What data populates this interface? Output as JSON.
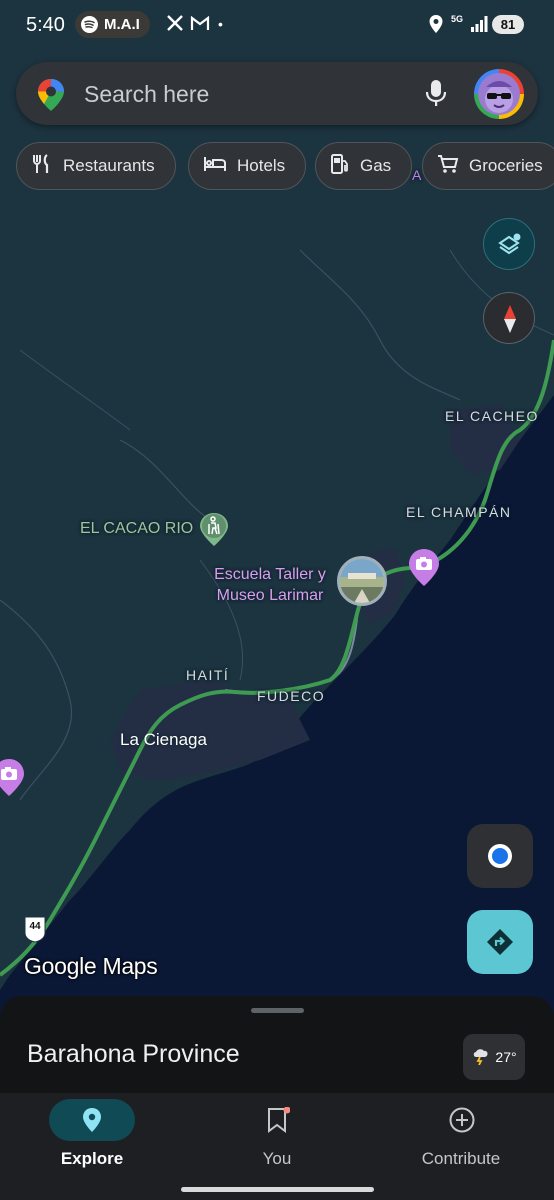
{
  "status_bar": {
    "time": "5:40",
    "media_label": "M.A.I",
    "dot": "•",
    "network": "5G",
    "battery": "81"
  },
  "search": {
    "placeholder": "Search here"
  },
  "chips": [
    {
      "label": "Restaurants",
      "icon": "fork-knife-icon"
    },
    {
      "label": "Hotels",
      "icon": "bed-icon"
    },
    {
      "label": "Gas",
      "icon": "gas-pump-icon"
    },
    {
      "label": "Groceries",
      "icon": "cart-icon"
    }
  ],
  "map": {
    "labels": {
      "el_cacheo": "EL CACHEO",
      "el_champan": "EL CHAMPÁN",
      "haiti": "HAITÍ",
      "fudeco": "FUDECO",
      "la_cienaga": "La Cienaga",
      "top_fragment": "A"
    },
    "pois": {
      "el_cacao": "EL CACAO RIO",
      "escuela": "Escuela Taller y\nMuseo Larimar"
    },
    "highway_shield": "44",
    "logo": "Google Maps",
    "colors": {
      "land": "#1c3340",
      "sea": "#0a1836",
      "urban": "#232e45",
      "highway": "#3f9a52",
      "poi_purple": "#c67de6"
    }
  },
  "sheet": {
    "title": "Barahona Province",
    "temperature": "27°"
  },
  "nav": {
    "explore": "Explore",
    "you": "You",
    "contribute": "Contribute"
  }
}
